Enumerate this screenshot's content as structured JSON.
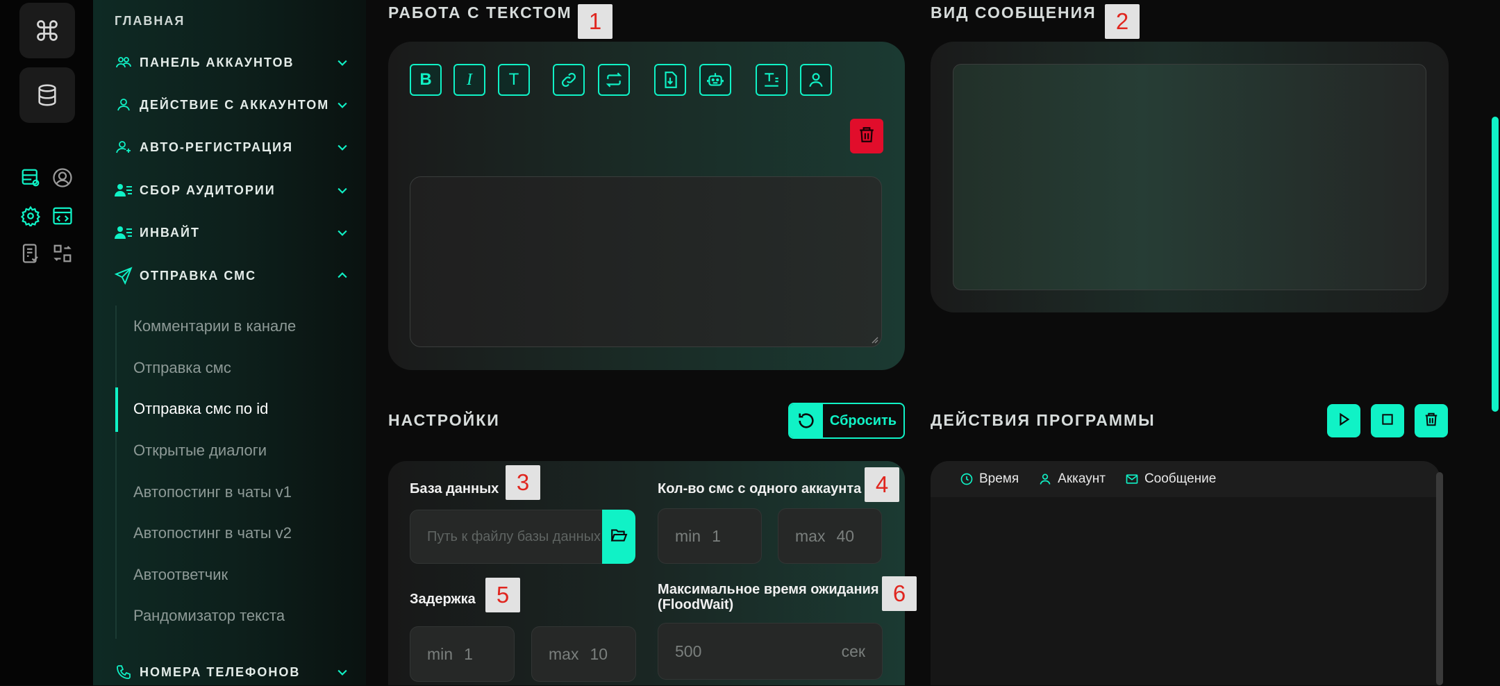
{
  "colors": {
    "accent": "#10f2c6",
    "danger": "#e10d2b",
    "badge_text": "#e0261f"
  },
  "rail": {
    "icons": [
      "command-icon",
      "database-icon",
      "table-settings-icon",
      "user-circle-icon",
      "gear-icon",
      "code-window-icon",
      "checklist-icon",
      "transfer-icon"
    ]
  },
  "sidebar": {
    "home": "ГЛАВНАЯ",
    "sections": [
      {
        "label": "ПАНЕЛЬ АККАУНТОВ",
        "icon": "users-icon",
        "expanded": false
      },
      {
        "label": "ДЕЙСТВИЕ С АККАУНТОМ",
        "icon": "user-icon",
        "expanded": false
      },
      {
        "label": "АВТО-РЕГИСТРАЦИЯ",
        "icon": "user-plus-icon",
        "expanded": false
      },
      {
        "label": "СБОР АУДИТОРИИ",
        "icon": "user-list-icon",
        "expanded": false
      },
      {
        "label": "ИНВАЙТ",
        "icon": "user-list-icon",
        "expanded": false
      },
      {
        "label": "ОТПРАВКА СМС",
        "icon": "send-icon",
        "expanded": true
      },
      {
        "label": "НОМЕРА ТЕЛЕФОНОВ",
        "icon": "phone-icon",
        "expanded": false
      }
    ],
    "subitems": [
      "Комментарии в канале",
      "Отправка смс",
      "Отправка смс по id",
      "Открытые диалоги",
      "Автопостинг в чаты v1",
      "Автопостинг в чаты v2",
      "Автоответчик",
      "Рандомизатор текста"
    ],
    "active_subitem": "Отправка смс по id"
  },
  "text_work": {
    "title": "РАБОТА С ТЕКСТОМ",
    "badge": "1",
    "toolbar": [
      "B",
      "I",
      "T"
    ],
    "toolbar_icons": [
      "link-icon",
      "repeat-icon",
      "file-import-icon",
      "robot-icon",
      "text-format-icon",
      "user-icon"
    ]
  },
  "preview": {
    "title": "ВИД СООБЩЕНИЯ",
    "badge": "2"
  },
  "settings": {
    "title": "НАСТРОЙКИ",
    "reset_label": "Сбросить",
    "db_label": "База данных",
    "db_badge": "3",
    "db_placeholder": "Путь к файлу базы данных",
    "sms_count_label": "Кол-во смс с одного аккаунта",
    "sms_count_badge": "4",
    "sms_min_key": "min",
    "sms_min": "1",
    "sms_max_key": "max",
    "sms_max": "40",
    "delay_label": "Задержка",
    "delay_badge": "5",
    "delay_min_key": "min",
    "delay_min": "1",
    "delay_max_key": "max",
    "delay_max": "10",
    "floodwait_label_1": "Максимальное время ожидания",
    "floodwait_label_2": "(FloodWait)",
    "floodwait_badge": "6",
    "floodwait_value": "500",
    "floodwait_unit": "сек"
  },
  "actions": {
    "title": "ДЕЙСТВИЯ ПРОГРАММЫ",
    "columns": [
      "Время",
      "Аккаунт",
      "Сообщение"
    ]
  }
}
